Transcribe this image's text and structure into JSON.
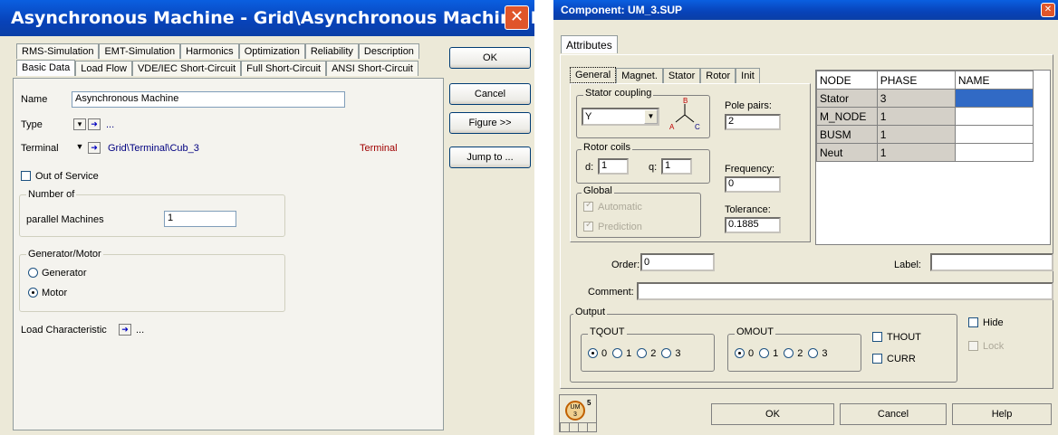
{
  "left": {
    "title": "Asynchronous Machine - Grid\\Asynchronous Machine.El...",
    "tabs_row1": [
      "RMS-Simulation",
      "EMT-Simulation",
      "Harmonics",
      "Optimization",
      "Reliability",
      "Description"
    ],
    "tabs_row2": [
      "Basic Data",
      "Load Flow",
      "VDE/IEC Short-Circuit",
      "Full Short-Circuit",
      "ANSI Short-Circuit"
    ],
    "name_label": "Name",
    "name_value": "Asynchronous Machine",
    "type_label": "Type",
    "type_value": "...",
    "terminal_label": "Terminal",
    "terminal_value": "Grid\\Terminal\\Cub_3",
    "terminal_right": "Terminal",
    "out_of_service": "Out of Service",
    "number_group": "Number of",
    "parallel_label": "parallel Machines",
    "parallel_value": "1",
    "genmotor_group": "Generator/Motor",
    "generator": "Generator",
    "motor": "Motor",
    "load_char": "Load Characteristic",
    "load_char_value": "...",
    "buttons": {
      "ok": "OK",
      "cancel": "Cancel",
      "figure": "Figure >>",
      "jump": "Jump to ..."
    }
  },
  "right": {
    "title": "Component: UM_3.SUP",
    "outer_tab": "Attributes",
    "tabs": [
      "General",
      "Magnet.",
      "Stator",
      "Rotor",
      "Init"
    ],
    "stator_coupling": "Stator coupling",
    "coupling_value": "Y",
    "pole_pairs_label": "Pole pairs:",
    "pole_pairs_value": "2",
    "rotor_coils": "Rotor coils",
    "d_label": "d:",
    "d_value": "1",
    "q_label": "q:",
    "q_value": "1",
    "frequency_label": "Frequency:",
    "frequency_value": "0",
    "global": "Global",
    "automatic": "Automatic",
    "prediction": "Prediction",
    "tolerance_label": "Tolerance:",
    "tolerance_value": "0.1885",
    "symbol_labels": {
      "b": "B",
      "a": "A",
      "c": "C"
    },
    "table": {
      "headers": [
        "NODE",
        "PHASE",
        "NAME"
      ],
      "rows": [
        [
          "Stator",
          "3",
          ""
        ],
        [
          "M_NODE",
          "1",
          ""
        ],
        [
          "BUSM",
          "1",
          ""
        ],
        [
          "Neut",
          "1",
          ""
        ]
      ]
    },
    "order_label": "Order:",
    "order_value": "0",
    "label_label": "Label:",
    "label_value": "",
    "comment_label": "Comment:",
    "comment_value": "",
    "output": "Output",
    "tqout": "TQOUT",
    "omout": "OMOUT",
    "radio_opts": [
      "0",
      "1",
      "2",
      "3"
    ],
    "thout": "THOUT",
    "curr": "CURR",
    "hide": "Hide",
    "lock": "Lock",
    "icon_text": "UM\n3",
    "icon_badge": "5",
    "buttons": {
      "ok": "OK",
      "cancel": "Cancel",
      "help": "Help"
    }
  }
}
